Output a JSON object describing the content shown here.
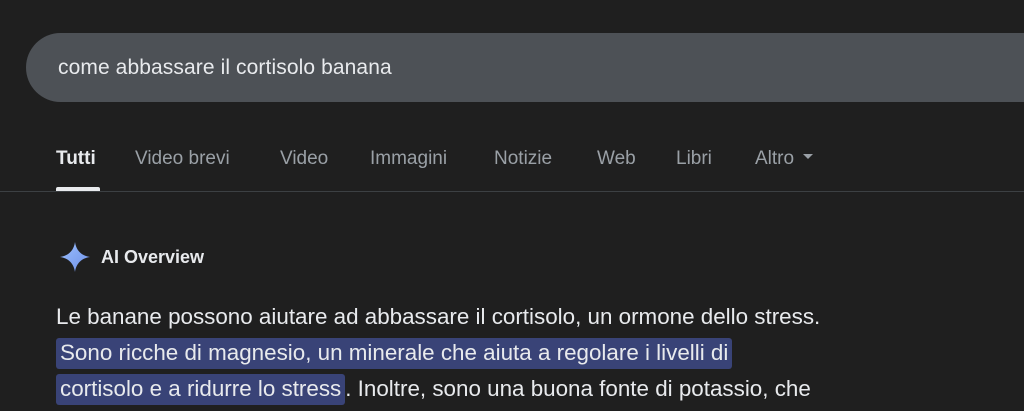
{
  "search": {
    "query": "come abbassare il cortisolo banana"
  },
  "tabs": [
    {
      "label": "Tutti",
      "active": true
    },
    {
      "label": "Video brevi",
      "active": false
    },
    {
      "label": "Video",
      "active": false
    },
    {
      "label": "Immagini",
      "active": false
    },
    {
      "label": "Notizie",
      "active": false
    },
    {
      "label": "Web",
      "active": false
    },
    {
      "label": "Libri",
      "active": false
    },
    {
      "label": "Altro",
      "active": false
    }
  ],
  "ai_overview": {
    "title": "AI Overview",
    "icon": "sparkle-icon",
    "sentence_1": "Le banane possono aiutare ad abbassare il cortisolo, un ormone dello stress.",
    "highlight_line_1": "Sono ricche di magnesio, un minerale che aiuta a regolare i livelli di",
    "highlight_line_2": "cortisolo e a ridurre lo stress",
    "sentence_3_start": ". Inoltre, sono una buona fonte di potassio, che"
  },
  "colors": {
    "background": "#1f1f1f",
    "search_bar": "#4d5156",
    "highlight": "#394377",
    "text": "#e8eaed",
    "muted_text": "#9aa0a6",
    "sparkle": "#8ab4f8"
  }
}
